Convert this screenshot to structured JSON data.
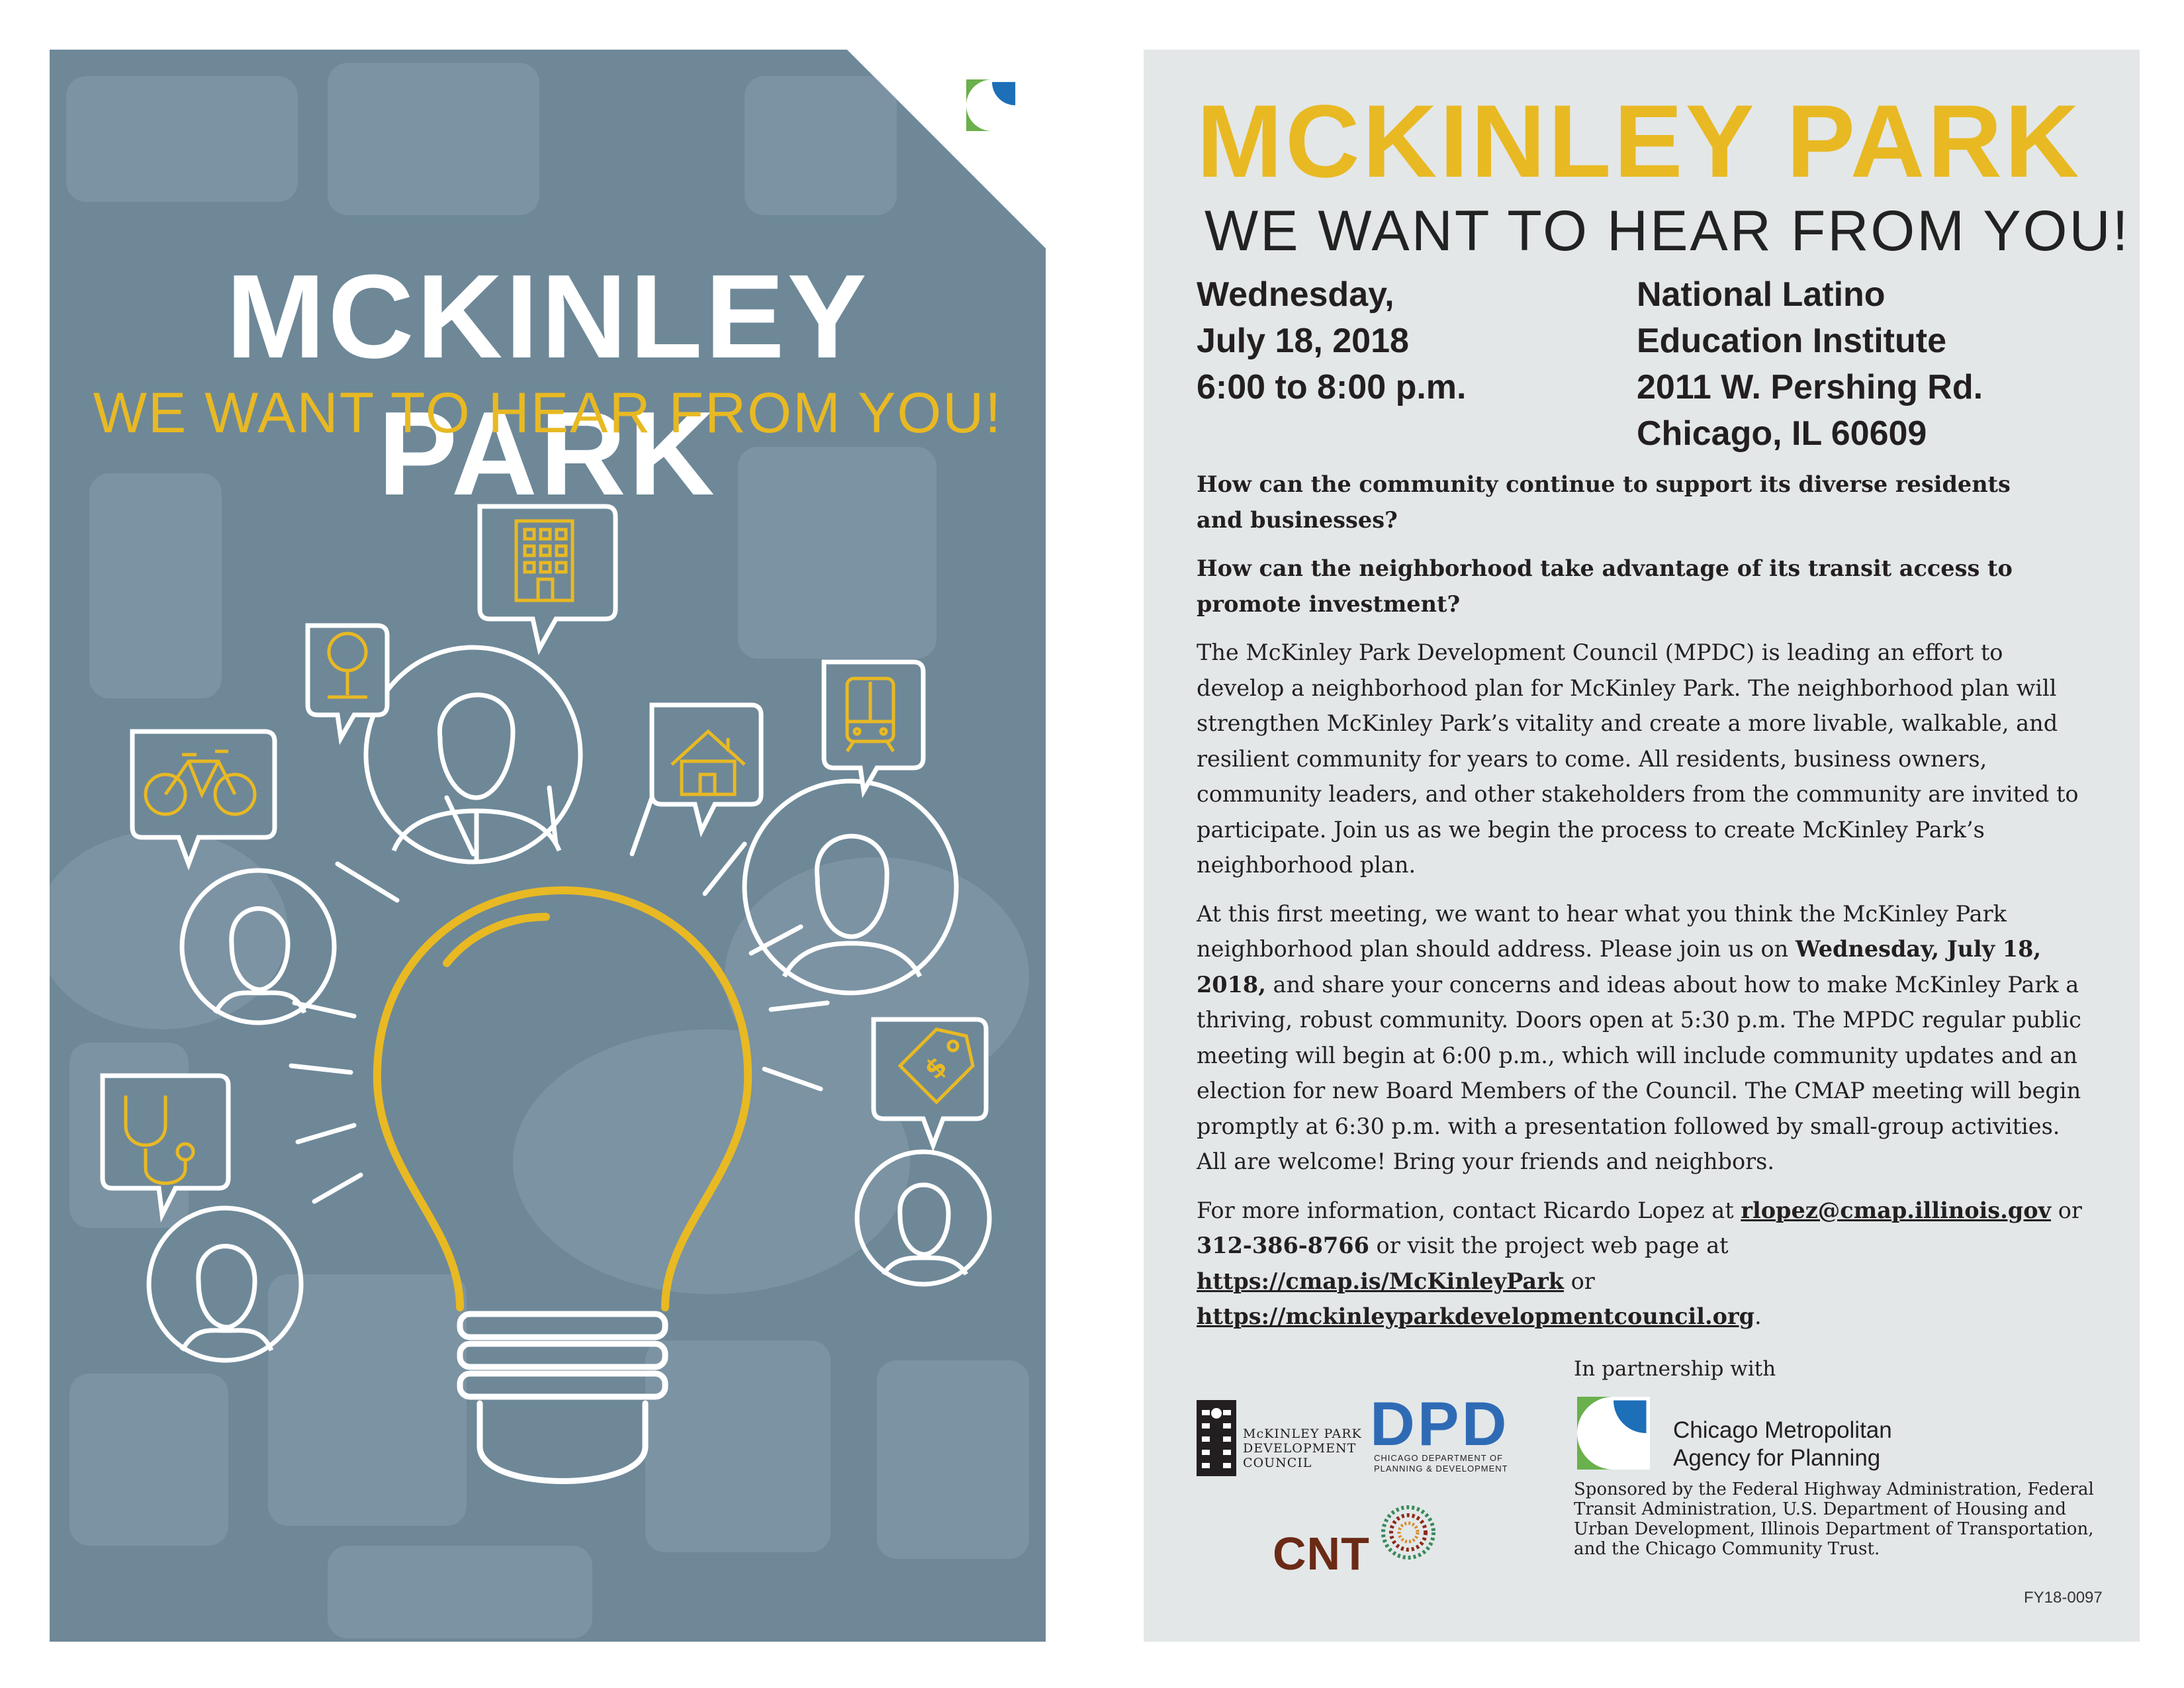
{
  "colors": {
    "left_panel_bg": "#6e8898",
    "accent_yellow": "#e8b923",
    "right_panel_bg": "#e3e7e8",
    "dpd_blue": "#2f6bb5",
    "cnt_brown": "#6b2a15",
    "cmap_green": "#6ab04c"
  },
  "left": {
    "title": "MCKINLEY PARK",
    "subtitle": "WE WANT TO HEAR FROM YOU!",
    "icons": [
      "building-icon",
      "tree-icon",
      "bicycle-icon",
      "house-icon",
      "train-icon",
      "price-tag-icon",
      "stethoscope-icon",
      "lightbulb-icon",
      "person-icon"
    ]
  },
  "right": {
    "title": "MCKINLEY PARK",
    "subtitle": "WE WANT TO HEAR FROM YOU!",
    "date_lines": [
      "Wednesday,",
      "July 18, 2018",
      "6:00 to 8:00 p.m."
    ],
    "venue_lines": [
      "National Latino",
      "Education Institute",
      "2011 W. Pershing Rd.",
      "Chicago, IL 60609"
    ],
    "question1": "How can the community continue to support its diverse residents and businesses?",
    "question2": "How can the neighborhood take advantage of its transit access to promote investment?",
    "para1": "The McKinley Park Development Council (MPDC) is leading an effort to develop a neighborhood plan for McKinley Park. The neighborhood plan will strengthen McKinley Park’s vitality and create a more livable, walkable, and resilient community for years to come. All residents, business owners, community leaders, and other stakeholders from the community are invited to participate. Join us as we begin the process to create McKinley Park’s neighborhood plan.",
    "para2_a": "At this first meeting, we want to hear what you think the McKinley Park neighborhood plan should address. Please join us on ",
    "para2_b": "Wednesday, July 18, 2018,",
    "para2_c": " and share your concerns and ideas about how to make McKinley Park a thriving, robust community. Doors open at 5:30 p.m. The MPDC regular public meeting will begin at 6:00 p.m., which will include community updates and an election for new Board Members of the Council. The CMAP meeting will begin promptly at 6:30 p.m. with a presentation followed by small-group activities. All are welcome! Bring your friends and neighbors.",
    "contact_a": "For more information, contact Ricardo Lopez at ",
    "email": "rlopez@cmap.illinois.gov",
    "contact_b": " or ",
    "phone": "312-386-8766",
    "contact_c": " or visit the project web page at ",
    "url1": "https://cmap.is/McKinleyPark",
    "contact_d": " or ",
    "url2": "https://mckinleyparkdevelopmentcouncil.org",
    "contact_e": ".",
    "partnership_label": "In partnership with",
    "mpdc_lines": [
      "McKINLEY PARK",
      "DEVELOPMENT",
      "COUNCIL"
    ],
    "dpd_abbr": "DPD",
    "dpd_lines": [
      "CHICAGO DEPARTMENT OF",
      "PLANNING & DEVELOPMENT"
    ],
    "cnt": "CNT",
    "cmap_lines": [
      "Chicago Metropolitan",
      "Agency for Planning"
    ],
    "sponsor": "Sponsored by the Federal Highway Administration, Federal Transit Administration, U.S. Department of Housing and Urban Development, Illinois Department of Transportation, and the Chicago Community Trust.",
    "code": "FY18-0097"
  }
}
